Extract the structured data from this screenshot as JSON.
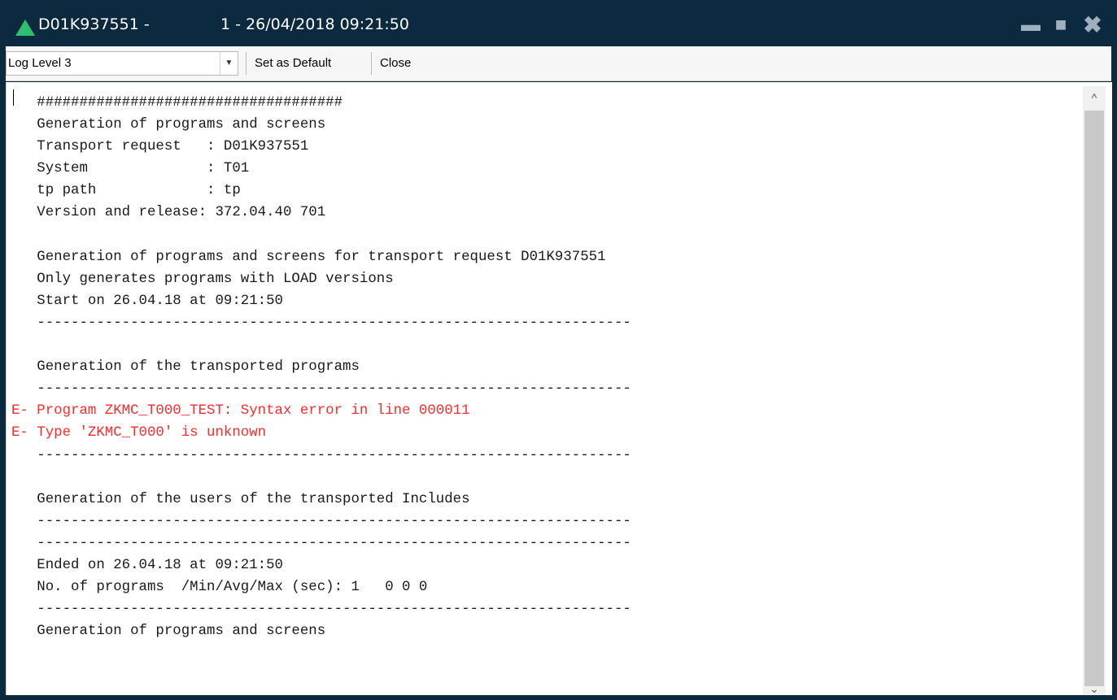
{
  "window": {
    "title_id": "D01K937551 -",
    "title_info": "1 - 26/04/2018 09:21:50",
    "icon": "app-triangle-icon",
    "accent_color": "#2fbf71",
    "titlebar_color": "#0b2a3f",
    "controls": {
      "minimize": "▬",
      "maximize": "■",
      "close": "✖"
    }
  },
  "toolbar": {
    "log_level": "Log Level 3",
    "dropdown_icon": "▼",
    "set_default_label": "Set as Default",
    "close_label": "Close"
  },
  "log": {
    "error_color": "#ff2b2b",
    "lines": [
      "   ####################################",
      "   Generation of programs and screens",
      "   Transport request   : D01K937551",
      "   System              : T01",
      "   tp path             : tp",
      "   Version and release: 372.04.40 701",
      "",
      "   Generation of programs and screens for transport request D01K937551",
      "   Only generates programs with LOAD versions",
      "   Start on 26.04.18 at 09:21:50",
      "   ----------------------------------------------------------------------",
      "",
      "   Generation of the transported programs",
      "   ----------------------------------------------------------------------",
      "E- Program ZKMC_T000_TEST: Syntax error in line 000011",
      "E- Type 'ZKMC_T000' is unknown",
      "   ----------------------------------------------------------------------",
      "",
      "   Generation of the users of the transported Includes",
      "   ----------------------------------------------------------------------",
      "   ----------------------------------------------------------------------",
      "   Ended on 26.04.18 at 09:21:50",
      "   No. of programs  /Min/Avg/Max (sec): 1   0 0 0",
      "   ----------------------------------------------------------------------",
      "   Generation of programs and screens"
    ]
  },
  "scrollbar": {
    "up_icon": "^",
    "down_icon": "⌄"
  }
}
